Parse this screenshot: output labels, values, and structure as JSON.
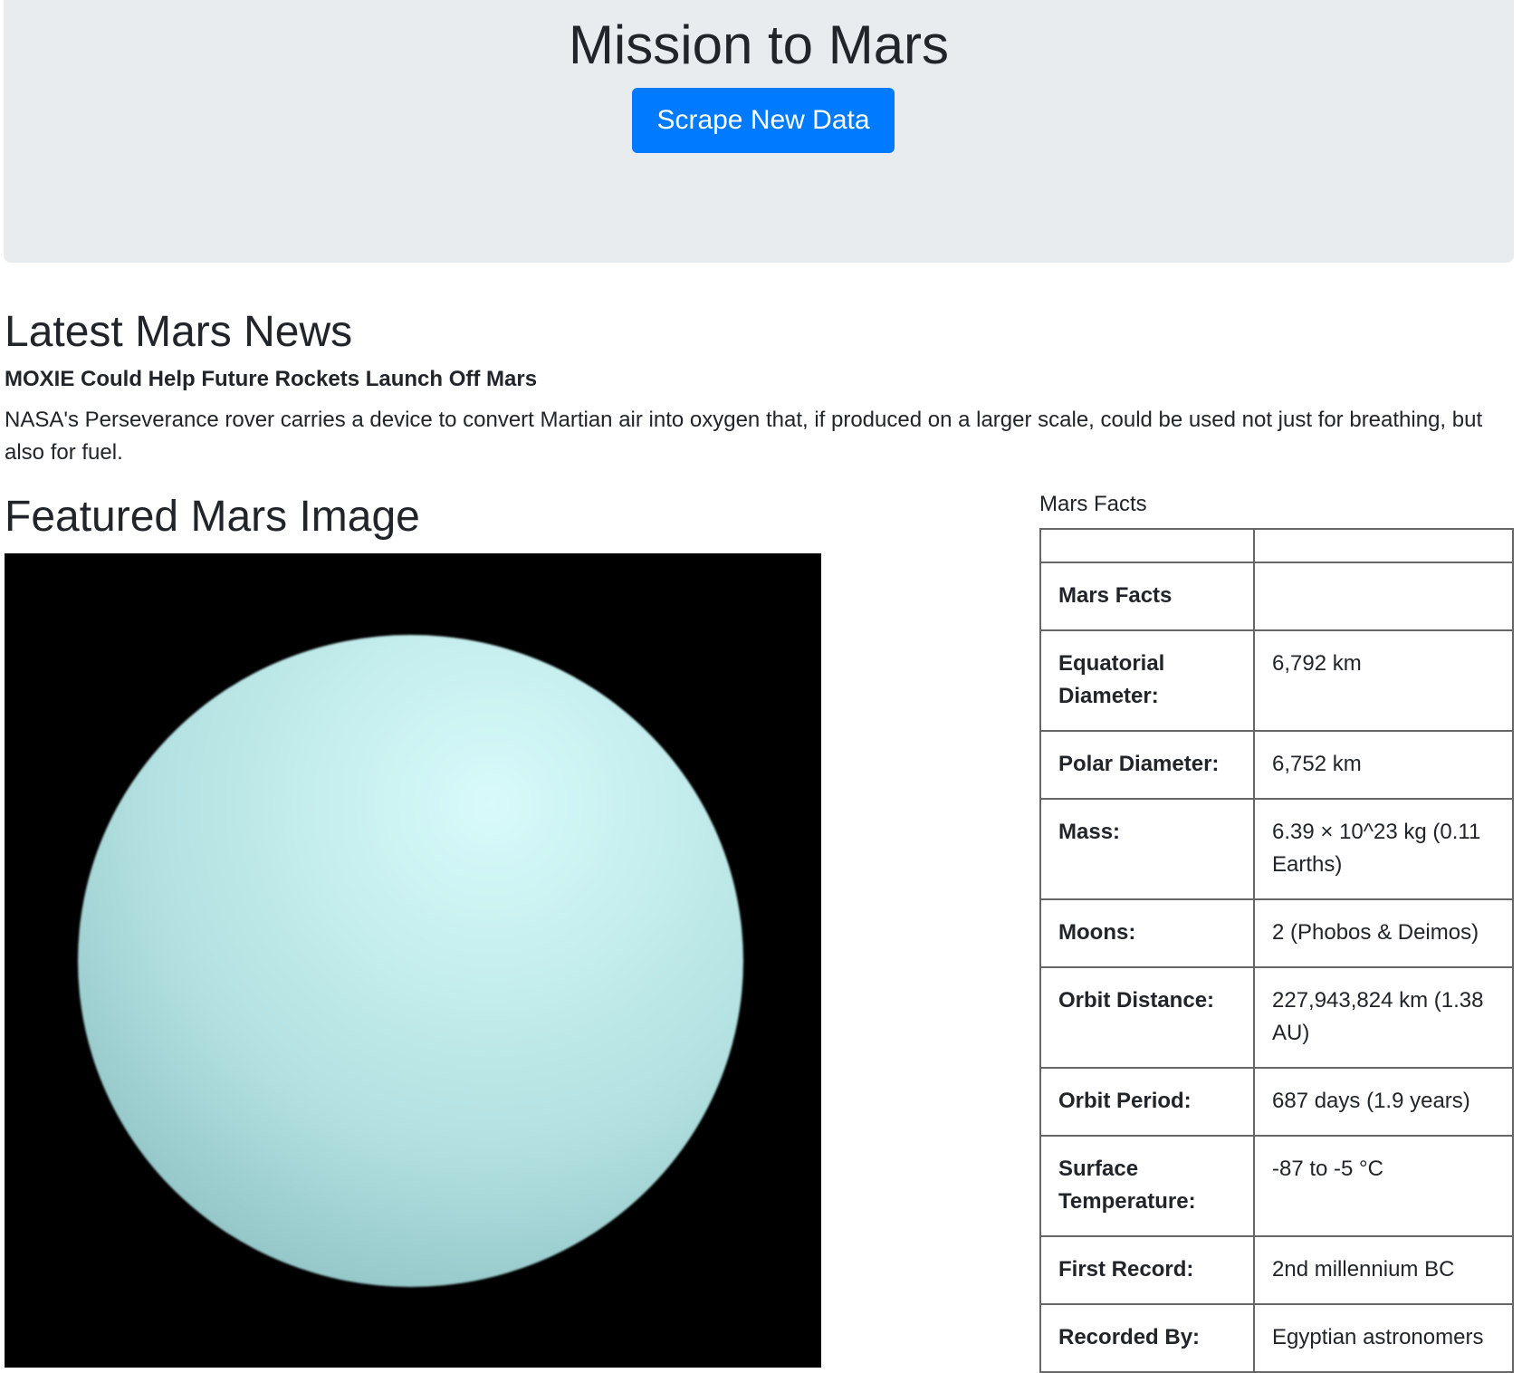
{
  "header": {
    "title": "Mission to Mars",
    "scrape_button": "Scrape New Data"
  },
  "news": {
    "heading": "Latest Mars News",
    "title": "MOXIE Could Help Future Rockets Launch Off Mars",
    "paragraph": "NASA's Perseverance rover carries a device to convert Martian air into oxygen that, if produced on a larger scale, could be used not just for breathing, but also for fuel."
  },
  "featured_image": {
    "heading": "Featured Mars Image"
  },
  "facts": {
    "caption": "Mars Facts",
    "header_row": [
      "",
      ""
    ],
    "rows": [
      {
        "label": "Mars Facts",
        "value": ""
      },
      {
        "label": "Equatorial Diameter:",
        "value": "6,792 km"
      },
      {
        "label": "Polar Diameter:",
        "value": "6,752 km"
      },
      {
        "label": "Mass:",
        "value": "6.39 × 10^23 kg (0.11 Earths)"
      },
      {
        "label": "Moons:",
        "value": "2 (Phobos & Deimos)"
      },
      {
        "label": "Orbit Distance:",
        "value": "227,943,824 km (1.38 AU)"
      },
      {
        "label": "Orbit Period:",
        "value": "687 days (1.9 years)"
      },
      {
        "label": "Surface Temperature:",
        "value": "-87 to -5 °C"
      },
      {
        "label": "First Record:",
        "value": "2nd millennium BC"
      },
      {
        "label": "Recorded By:",
        "value": "Egyptian astronomers"
      }
    ]
  }
}
